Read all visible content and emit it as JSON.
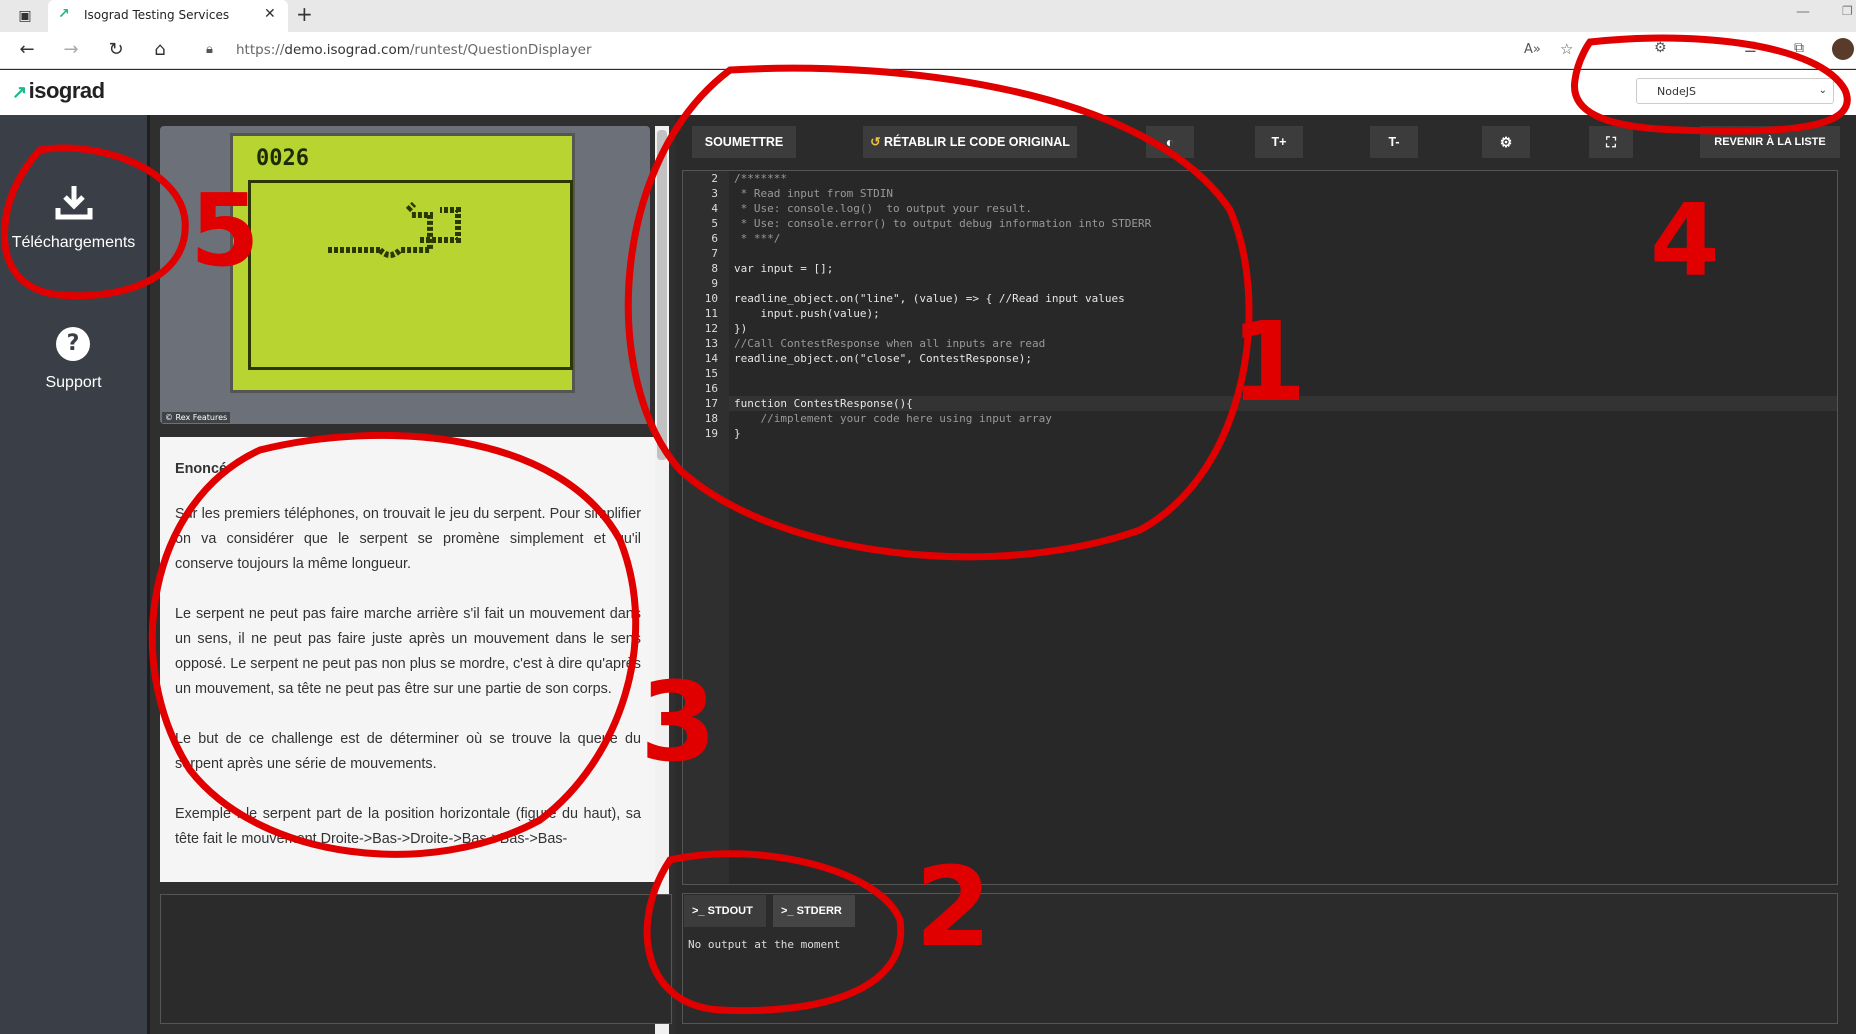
{
  "browser": {
    "tab_title": "Isograd Testing Services",
    "url_prefix": "https://",
    "url_host": "demo.isograd.com",
    "url_path": "/runtest/QuestionDisplayer"
  },
  "header": {
    "logo_text": "isograd",
    "language_select": "NodeJS"
  },
  "sidebar": {
    "items": [
      {
        "label": "Téléchargements",
        "icon": "download-icon"
      },
      {
        "label": "Support",
        "icon": "help-icon"
      }
    ]
  },
  "image": {
    "score": "0026",
    "credit": "© Rex Features"
  },
  "statement": {
    "heading": "Enoncé",
    "paragraphs": [
      "Sur les premiers téléphones, on trouvait le jeu du serpent. Pour simplifier on va considérer que le serpent se promène simplement et qu'il conserve toujours la même longueur.",
      "Le serpent ne peut pas faire marche arrière s'il fait un mouvement dans un sens, il ne peut pas faire juste après un mouvement dans le sens opposé. Le serpent ne peut pas non plus se mordre, c'est à dire qu'après un mouvement, sa tête ne peut pas être sur une partie de son corps.",
      "Le but de ce challenge est de déterminer où se trouve la queue du serpent après une série de mouvements.",
      "Exemple : le serpent part de la position horizontale (figure du haut), sa tête fait le mouvement Droite->Bas->Droite->Bas->Bas->Bas-"
    ]
  },
  "toolbar": {
    "submit": "SOUMETTRE",
    "reset": "RÉTABLIR LE CODE ORIGINAL",
    "back": "REVENIR À LA LISTE",
    "font_up": "T+",
    "font_down": "T-"
  },
  "editor": {
    "lines": [
      {
        "n": "2",
        "text": "/*******"
      },
      {
        "n": "3",
        "text": " * Read input from STDIN"
      },
      {
        "n": "4",
        "text": " * Use: console.log()  to output your result."
      },
      {
        "n": "5",
        "text": " * Use: console.error() to output debug information into STDERR"
      },
      {
        "n": "6",
        "text": " * ***/"
      },
      {
        "n": "7",
        "text": ""
      },
      {
        "n": "8",
        "text": "var input = [];"
      },
      {
        "n": "9",
        "text": ""
      },
      {
        "n": "10",
        "text": "readline_object.on(\"line\", (value) => { //Read input values"
      },
      {
        "n": "11",
        "text": "    input.push(value);"
      },
      {
        "n": "12",
        "text": "})"
      },
      {
        "n": "13",
        "text": "//Call ContestResponse when all inputs are read"
      },
      {
        "n": "14",
        "text": "readline_object.on(\"close\", ContestResponse);"
      },
      {
        "n": "15",
        "text": ""
      },
      {
        "n": "16",
        "text": ""
      },
      {
        "n": "17",
        "text": "function ContestResponse(){"
      },
      {
        "n": "18",
        "text": "    //implement your code here using input array"
      },
      {
        "n": "19",
        "text": "}"
      }
    ]
  },
  "console": {
    "tabs": [
      "STDOUT",
      "STDERR"
    ],
    "output": "No output at the moment"
  },
  "annotations": [
    "1",
    "2",
    "3",
    "4",
    "5"
  ],
  "colors": {
    "accent": "#1fb88e",
    "annotation": "#e00000",
    "sidebar": "#3a3f47",
    "editor_bg": "#282828"
  }
}
